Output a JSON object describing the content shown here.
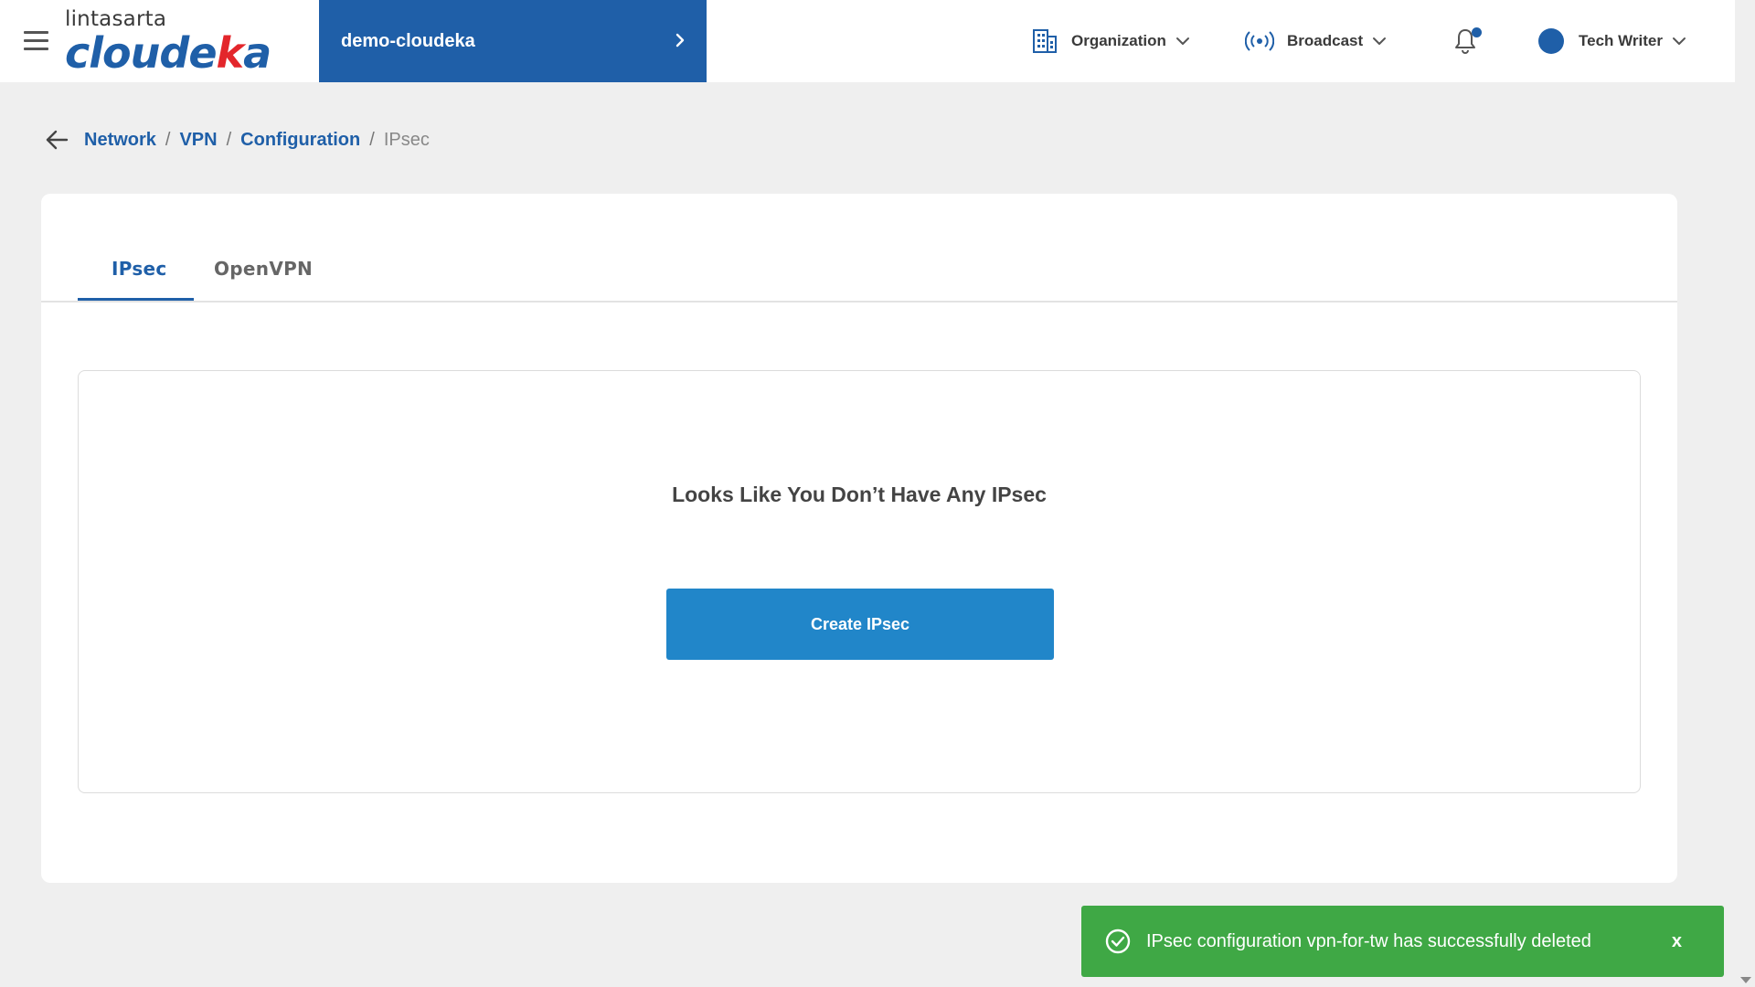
{
  "header": {
    "logo_top": "lintasarta",
    "logo_main_start": "cloude",
    "logo_main_accent": "k",
    "logo_main_end": "a",
    "project_name": "demo-cloudeka",
    "organization_label": "Organization",
    "broadcast_label": "Broadcast",
    "user_name": "Tech Writer"
  },
  "breadcrumb": {
    "items": [
      "Network",
      "VPN",
      "Configuration"
    ],
    "separator": "/",
    "current": "IPsec"
  },
  "tabs": [
    {
      "label": "IPsec",
      "active": true
    },
    {
      "label": "OpenVPN",
      "active": false
    }
  ],
  "empty_state": {
    "title": "Looks Like You Don’t Have Any IPsec",
    "button_label": "Create IPsec"
  },
  "toast": {
    "message": "IPsec configuration vpn-for-tw has successfully deleted",
    "close_label": "x"
  },
  "colors": {
    "brand_blue": "#1f5fa8",
    "button_blue": "#2186c9",
    "success_green": "#3fa845",
    "logo_red": "#e3262b"
  },
  "icons": [
    "menu-icon",
    "chevron-right-icon",
    "building-icon",
    "broadcast-icon",
    "bell-icon",
    "chevron-down-icon",
    "arrow-left-icon",
    "check-circle-icon"
  ]
}
